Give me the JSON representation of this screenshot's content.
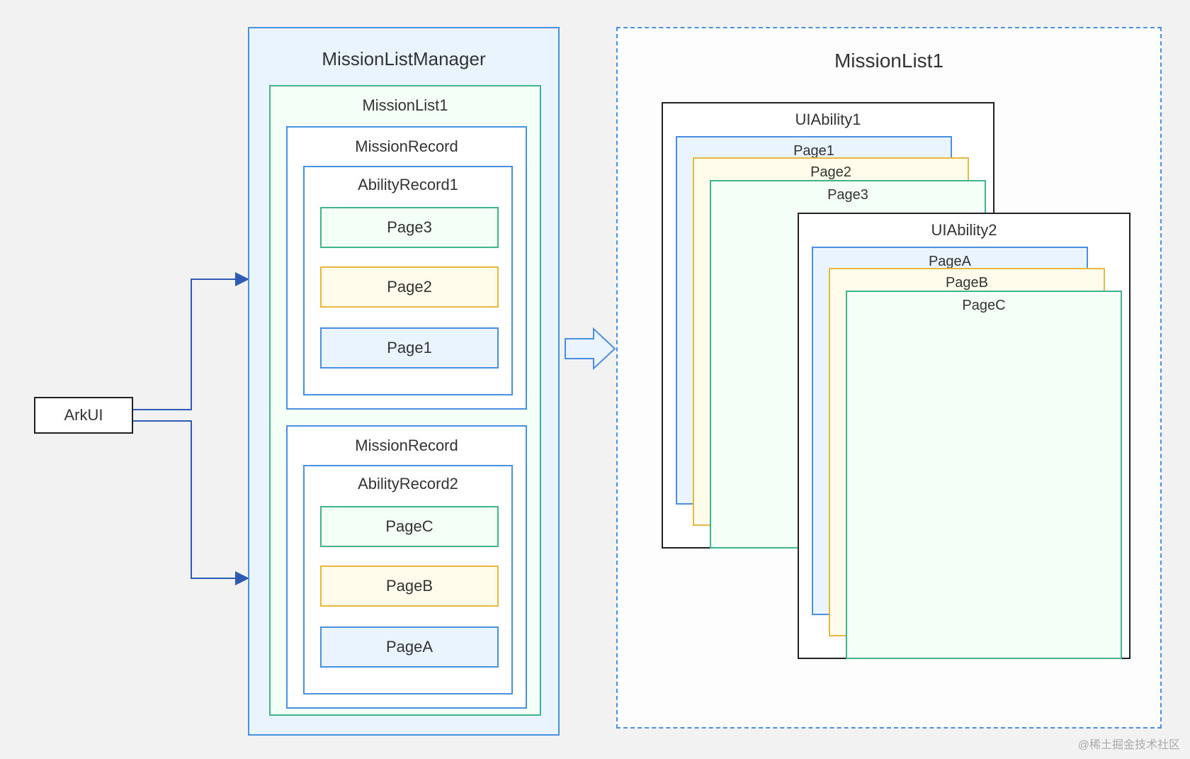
{
  "watermark": "@稀土掘金技术社区",
  "arkui": {
    "label": "ArkUI"
  },
  "missionListManager": {
    "title": "MissionListManager",
    "missionList": {
      "title": "MissionList1",
      "records": [
        {
          "title": "MissionRecord",
          "ability": {
            "title": "AbilityRecord1",
            "pages": [
              {
                "label": "Page3",
                "color": "green"
              },
              {
                "label": "Page2",
                "color": "yellow"
              },
              {
                "label": "Page1",
                "color": "blue"
              }
            ]
          }
        },
        {
          "title": "MissionRecord",
          "ability": {
            "title": "AbilityRecord2",
            "pages": [
              {
                "label": "PageC",
                "color": "green"
              },
              {
                "label": "PageB",
                "color": "yellow"
              },
              {
                "label": "PageA",
                "color": "blue"
              }
            ]
          }
        }
      ]
    }
  },
  "missionListRight": {
    "title": "MissionList1",
    "abilities": [
      {
        "title": "UIAbility1",
        "pages": [
          {
            "label": "Page1",
            "color": "blue"
          },
          {
            "label": "Page2",
            "color": "yellow"
          },
          {
            "label": "Page3",
            "color": "green"
          }
        ]
      },
      {
        "title": "UIAbility2",
        "pages": [
          {
            "label": "PageA",
            "color": "blue"
          },
          {
            "label": "PageB",
            "color": "yellow"
          },
          {
            "label": "PageC",
            "color": "green"
          }
        ]
      }
    ]
  }
}
